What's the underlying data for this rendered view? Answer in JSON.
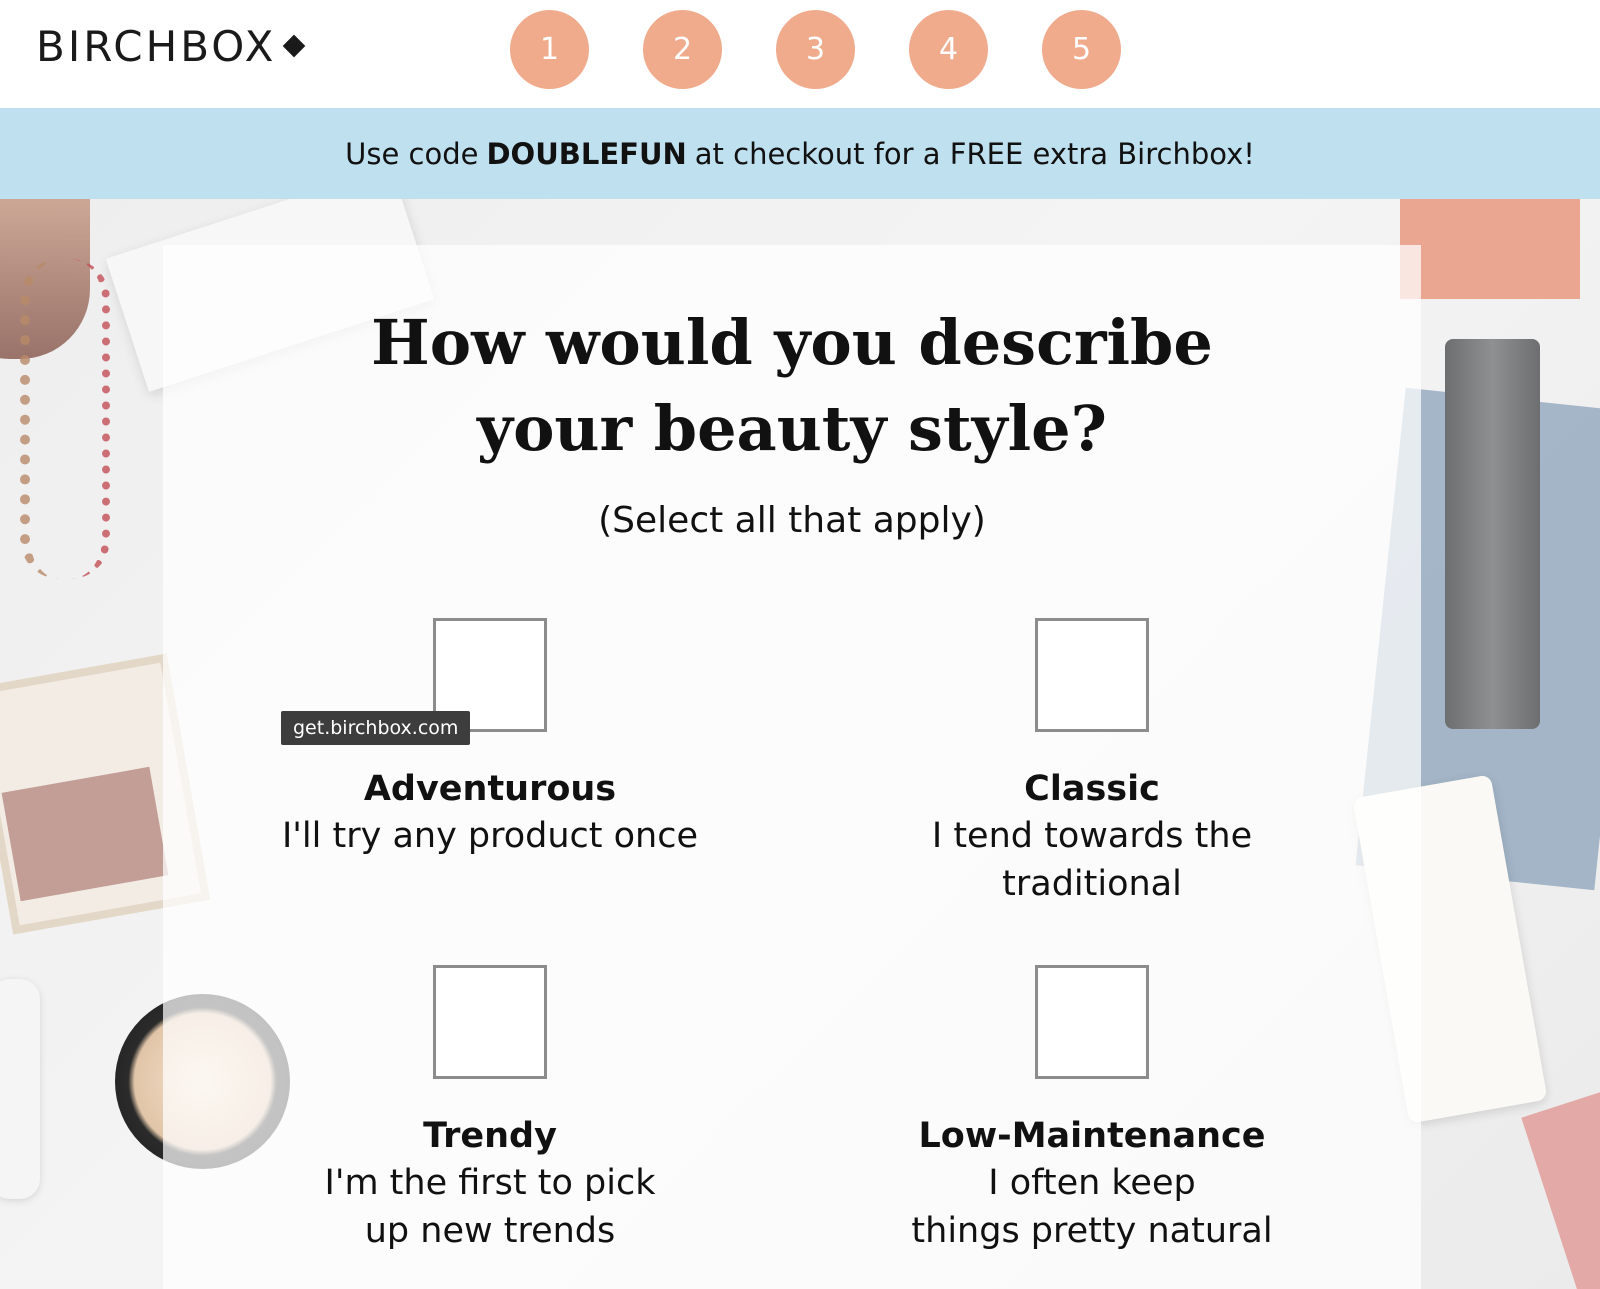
{
  "header": {
    "logo": "BIRCHBOX",
    "steps": [
      "1",
      "2",
      "3",
      "4",
      "5"
    ]
  },
  "promo": {
    "before": "Use code",
    "code": "DOUBLEFUN",
    "after": "at checkout for a FREE extra Birchbox!"
  },
  "question": {
    "title_line1": "How would you describe",
    "title_line2": "your beauty style?",
    "subtitle": "(Select all that apply)"
  },
  "options": [
    {
      "title": "Adventurous",
      "desc_line1": "I'll try any product once",
      "desc_line2": ""
    },
    {
      "title": "Classic",
      "desc_line1": "I tend towards the",
      "desc_line2": "traditional"
    },
    {
      "title": "Trendy",
      "desc_line1": "I'm the first to pick",
      "desc_line2": "up new trends"
    },
    {
      "title": "Low-Maintenance",
      "desc_line1": "I often keep",
      "desc_line2": "things pretty natural"
    }
  ],
  "tooltip": "get.birchbox.com",
  "colors": {
    "step_circle": "#f0ab8c",
    "promo_bg": "#bfe0ef",
    "checkbox_border": "#8c8c8c"
  }
}
